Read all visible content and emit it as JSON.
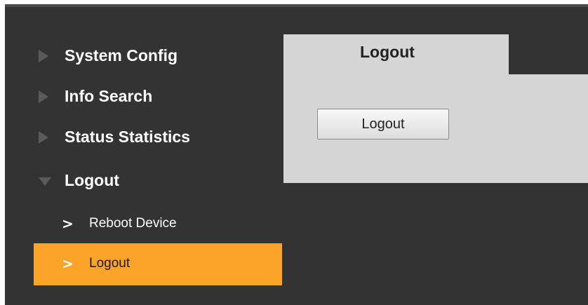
{
  "sidebar": {
    "items": [
      {
        "label": "System Config",
        "icon": "triangle-right-icon"
      },
      {
        "label": "Info Search",
        "icon": "triangle-right-icon"
      },
      {
        "label": "Status Statistics",
        "icon": "triangle-right-icon"
      },
      {
        "label": "Logout",
        "icon": "triangle-down-icon"
      }
    ],
    "sub_items": [
      {
        "label": "Reboot Device",
        "icon": "chevron-right-icon",
        "active": false
      },
      {
        "label": "Logout",
        "icon": "chevron-right-icon",
        "active": true
      }
    ]
  },
  "content": {
    "tab_label": "Logout",
    "button_label": "Logout"
  },
  "colors": {
    "background": "#333333",
    "active": "#fca42a",
    "panel": "#d6d6d6"
  }
}
